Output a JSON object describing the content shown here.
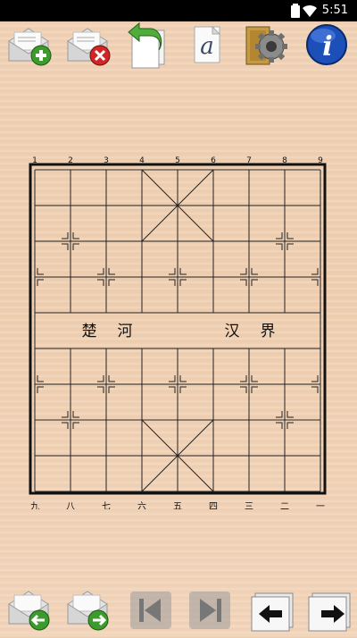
{
  "status_bar": {
    "time": "5:51"
  },
  "toolbar_top": {
    "buttons": [
      {
        "name": "new-game-button",
        "icon": "envelope-plus-icon"
      },
      {
        "name": "close-game-button",
        "icon": "envelope-x-icon"
      },
      {
        "name": "undo-button",
        "icon": "undo-arrow-icon"
      },
      {
        "name": "font-button",
        "icon": "letter-a-icon"
      },
      {
        "name": "settings-button",
        "icon": "gear-icon"
      },
      {
        "name": "info-button",
        "icon": "info-icon"
      }
    ]
  },
  "board": {
    "file_labels_top": [
      "1",
      "2",
      "3",
      "4",
      "5",
      "6",
      "7",
      "8",
      "9"
    ],
    "file_labels_bottom": [
      "九",
      "八",
      "七",
      "六",
      "五",
      "四",
      "三",
      "二",
      "一"
    ],
    "river_left": [
      "楚",
      "河"
    ],
    "river_right": [
      "汉",
      "界"
    ]
  },
  "toolbar_bottom": {
    "buttons": [
      {
        "name": "prev-move-button",
        "icon": "envelope-left-arrow-icon"
      },
      {
        "name": "next-move-button",
        "icon": "envelope-right-arrow-icon"
      },
      {
        "name": "first-move-button",
        "icon": "skip-first-icon"
      },
      {
        "name": "last-move-button",
        "icon": "skip-last-icon"
      },
      {
        "name": "step-back-button",
        "icon": "arrow-left-icon"
      },
      {
        "name": "step-forward-button",
        "icon": "arrow-right-icon"
      }
    ]
  }
}
